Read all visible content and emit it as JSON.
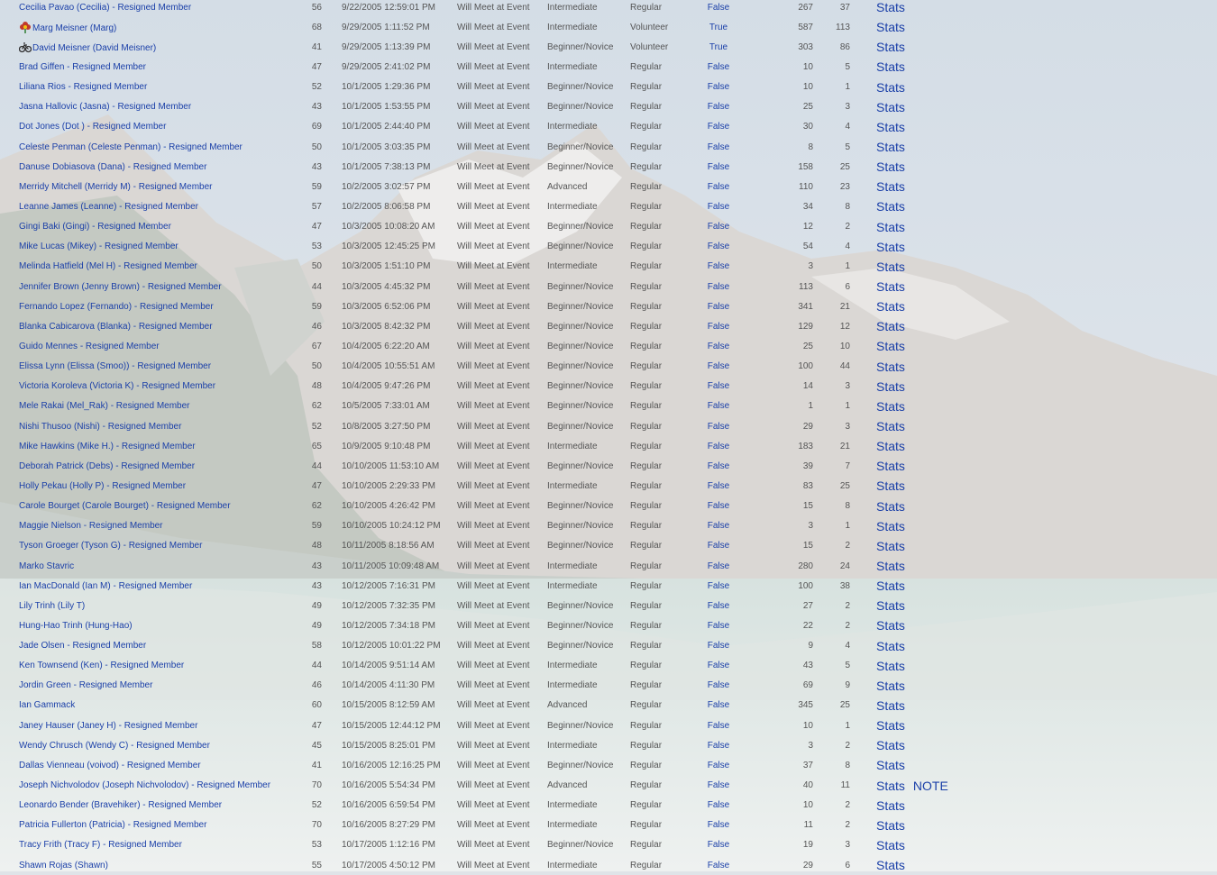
{
  "colors": {
    "link": "#1a3fa8",
    "text": "#555555"
  },
  "rows": [
    {
      "name": "Cecilia Pavao (Cecilia) - Resigned Member",
      "age": "56",
      "date": "9/22/2005 12:59:01 PM",
      "meet": "Will Meet at Event",
      "level": "Intermediate",
      "status": "Regular",
      "flag": "False",
      "n1": "267",
      "n2": "37",
      "stats": "Stats",
      "note": ""
    },
    {
      "name": "Marg Meisner (Marg)",
      "icon": "flower-icon",
      "age": "68",
      "date": "9/29/2005 1:11:52 PM",
      "meet": "Will Meet at Event",
      "level": "Intermediate",
      "status": "Volunteer",
      "flag": "True",
      "n1": "587",
      "n2": "113",
      "stats": "Stats",
      "note": ""
    },
    {
      "name": "David Meisner (David Meisner)",
      "icon": "bicycle-icon",
      "age": "41",
      "date": "9/29/2005 1:13:39 PM",
      "meet": "Will Meet at Event",
      "level": "Beginner/Novice",
      "status": "Volunteer",
      "flag": "True",
      "n1": "303",
      "n2": "86",
      "stats": "Stats",
      "note": ""
    },
    {
      "name": "Brad Giffen - Resigned Member",
      "age": "47",
      "date": "9/29/2005 2:41:02 PM",
      "meet": "Will Meet at Event",
      "level": "Intermediate",
      "status": "Regular",
      "flag": "False",
      "n1": "10",
      "n2": "5",
      "stats": "Stats",
      "note": ""
    },
    {
      "name": "Liliana Rios - Resigned Member",
      "age": "52",
      "date": "10/1/2005 1:29:36 PM",
      "meet": "Will Meet at Event",
      "level": "Beginner/Novice",
      "status": "Regular",
      "flag": "False",
      "n1": "10",
      "n2": "1",
      "stats": "Stats",
      "note": ""
    },
    {
      "name": "Jasna Hallovic (Jasna) - Resigned Member",
      "age": "43",
      "date": "10/1/2005 1:53:55 PM",
      "meet": "Will Meet at Event",
      "level": "Beginner/Novice",
      "status": "Regular",
      "flag": "False",
      "n1": "25",
      "n2": "3",
      "stats": "Stats",
      "note": ""
    },
    {
      "name": "Dot Jones (Dot ) - Resigned Member",
      "age": "69",
      "date": "10/1/2005 2:44:40 PM",
      "meet": "Will Meet at Event",
      "level": "Intermediate",
      "status": "Regular",
      "flag": "False",
      "n1": "30",
      "n2": "4",
      "stats": "Stats",
      "note": ""
    },
    {
      "name": "Celeste Penman (Celeste Penman) - Resigned Member",
      "age": "50",
      "date": "10/1/2005 3:03:35 PM",
      "meet": "Will Meet at Event",
      "level": "Beginner/Novice",
      "status": "Regular",
      "flag": "False",
      "n1": "8",
      "n2": "5",
      "stats": "Stats",
      "note": ""
    },
    {
      "name": "Danuse Dobiasova (Dana) - Resigned Member",
      "age": "43",
      "date": "10/1/2005 7:38:13 PM",
      "meet": "Will Meet at Event",
      "level": "Beginner/Novice",
      "status": "Regular",
      "flag": "False",
      "n1": "158",
      "n2": "25",
      "stats": "Stats",
      "note": ""
    },
    {
      "name": "Merridy Mitchell (Merridy M) - Resigned Member",
      "age": "59",
      "date": "10/2/2005 3:02:57 PM",
      "meet": "Will Meet at Event",
      "level": "Advanced",
      "status": "Regular",
      "flag": "False",
      "n1": "110",
      "n2": "23",
      "stats": "Stats",
      "note": ""
    },
    {
      "name": "Leanne James (Leanne) - Resigned Member",
      "age": "57",
      "date": "10/2/2005 8:06:58 PM",
      "meet": "Will Meet at Event",
      "level": "Intermediate",
      "status": "Regular",
      "flag": "False",
      "n1": "34",
      "n2": "8",
      "stats": "Stats",
      "note": ""
    },
    {
      "name": "Gingi Baki (Gingi) - Resigned Member",
      "age": "47",
      "date": "10/3/2005 10:08:20 AM",
      "meet": "Will Meet at Event",
      "level": "Beginner/Novice",
      "status": "Regular",
      "flag": "False",
      "n1": "12",
      "n2": "2",
      "stats": "Stats",
      "note": ""
    },
    {
      "name": "Mike Lucas (Mikey) - Resigned Member",
      "age": "53",
      "date": "10/3/2005 12:45:25 PM",
      "meet": "Will Meet at Event",
      "level": "Beginner/Novice",
      "status": "Regular",
      "flag": "False",
      "n1": "54",
      "n2": "4",
      "stats": "Stats",
      "note": ""
    },
    {
      "name": "Melinda Hatfield (Mel H) - Resigned Member",
      "age": "50",
      "date": "10/3/2005 1:51:10 PM",
      "meet": "Will Meet at Event",
      "level": "Intermediate",
      "status": "Regular",
      "flag": "False",
      "n1": "3",
      "n2": "1",
      "stats": "Stats",
      "note": ""
    },
    {
      "name": "Jennifer Brown (Jenny Brown) - Resigned Member",
      "age": "44",
      "date": "10/3/2005 4:45:32 PM",
      "meet": "Will Meet at Event",
      "level": "Beginner/Novice",
      "status": "Regular",
      "flag": "False",
      "n1": "113",
      "n2": "6",
      "stats": "Stats",
      "note": ""
    },
    {
      "name": "Fernando Lopez (Fernando) - Resigned Member",
      "age": "59",
      "date": "10/3/2005 6:52:06 PM",
      "meet": "Will Meet at Event",
      "level": "Beginner/Novice",
      "status": "Regular",
      "flag": "False",
      "n1": "341",
      "n2": "21",
      "stats": "Stats",
      "note": ""
    },
    {
      "name": "Blanka Cabicarova (Blanka) - Resigned Member",
      "age": "46",
      "date": "10/3/2005 8:42:32 PM",
      "meet": "Will Meet at Event",
      "level": "Beginner/Novice",
      "status": "Regular",
      "flag": "False",
      "n1": "129",
      "n2": "12",
      "stats": "Stats",
      "note": ""
    },
    {
      "name": "Guido Mennes - Resigned Member",
      "age": "67",
      "date": "10/4/2005 6:22:20 AM",
      "meet": "Will Meet at Event",
      "level": "Beginner/Novice",
      "status": "Regular",
      "flag": "False",
      "n1": "25",
      "n2": "10",
      "stats": "Stats",
      "note": ""
    },
    {
      "name": "Elissa Lynn (Elissa (Smoo)) - Resigned Member",
      "age": "50",
      "date": "10/4/2005 10:55:51 AM",
      "meet": "Will Meet at Event",
      "level": "Beginner/Novice",
      "status": "Regular",
      "flag": "False",
      "n1": "100",
      "n2": "44",
      "stats": "Stats",
      "note": ""
    },
    {
      "name": "Victoria Koroleva (Victoria K) - Resigned Member",
      "age": "48",
      "date": "10/4/2005 9:47:26 PM",
      "meet": "Will Meet at Event",
      "level": "Beginner/Novice",
      "status": "Regular",
      "flag": "False",
      "n1": "14",
      "n2": "3",
      "stats": "Stats",
      "note": ""
    },
    {
      "name": "Mele Rakai (Mel_Rak) - Resigned Member",
      "age": "62",
      "date": "10/5/2005 7:33:01 AM",
      "meet": "Will Meet at Event",
      "level": "Beginner/Novice",
      "status": "Regular",
      "flag": "False",
      "n1": "1",
      "n2": "1",
      "stats": "Stats",
      "note": ""
    },
    {
      "name": "Nishi Thusoo (Nishi) - Resigned Member",
      "age": "52",
      "date": "10/8/2005 3:27:50 PM",
      "meet": "Will Meet at Event",
      "level": "Beginner/Novice",
      "status": "Regular",
      "flag": "False",
      "n1": "29",
      "n2": "3",
      "stats": "Stats",
      "note": ""
    },
    {
      "name": "Mike Hawkins (Mike H.) - Resigned Member",
      "age": "65",
      "date": "10/9/2005 9:10:48 PM",
      "meet": "Will Meet at Event",
      "level": "Intermediate",
      "status": "Regular",
      "flag": "False",
      "n1": "183",
      "n2": "21",
      "stats": "Stats",
      "note": ""
    },
    {
      "name": "Deborah Patrick (Debs) - Resigned Member",
      "age": "44",
      "date": "10/10/2005 11:53:10 AM",
      "meet": "Will Meet at Event",
      "level": "Beginner/Novice",
      "status": "Regular",
      "flag": "False",
      "n1": "39",
      "n2": "7",
      "stats": "Stats",
      "note": ""
    },
    {
      "name": "Holly Pekau (Holly P) - Resigned Member",
      "age": "47",
      "date": "10/10/2005 2:29:33 PM",
      "meet": "Will Meet at Event",
      "level": "Intermediate",
      "status": "Regular",
      "flag": "False",
      "n1": "83",
      "n2": "25",
      "stats": "Stats",
      "note": ""
    },
    {
      "name": "Carole Bourget (Carole Bourget) - Resigned Member",
      "age": "62",
      "date": "10/10/2005 4:26:42 PM",
      "meet": "Will Meet at Event",
      "level": "Beginner/Novice",
      "status": "Regular",
      "flag": "False",
      "n1": "15",
      "n2": "8",
      "stats": "Stats",
      "note": ""
    },
    {
      "name": "Maggie Nielson - Resigned Member",
      "age": "59",
      "date": "10/10/2005 10:24:12 PM",
      "meet": "Will Meet at Event",
      "level": "Beginner/Novice",
      "status": "Regular",
      "flag": "False",
      "n1": "3",
      "n2": "1",
      "stats": "Stats",
      "note": ""
    },
    {
      "name": "Tyson Groeger (Tyson G) - Resigned Member",
      "age": "48",
      "date": "10/11/2005 8:18:56 AM",
      "meet": "Will Meet at Event",
      "level": "Beginner/Novice",
      "status": "Regular",
      "flag": "False",
      "n1": "15",
      "n2": "2",
      "stats": "Stats",
      "note": ""
    },
    {
      "name": "Marko Stavric",
      "age": "43",
      "date": "10/11/2005 10:09:48 AM",
      "meet": "Will Meet at Event",
      "level": "Intermediate",
      "status": "Regular",
      "flag": "False",
      "n1": "280",
      "n2": "24",
      "stats": "Stats",
      "note": ""
    },
    {
      "name": "Ian MacDonald (Ian M) - Resigned Member",
      "age": "43",
      "date": "10/12/2005 7:16:31 PM",
      "meet": "Will Meet at Event",
      "level": "Intermediate",
      "status": "Regular",
      "flag": "False",
      "n1": "100",
      "n2": "38",
      "stats": "Stats",
      "note": ""
    },
    {
      "name": "Lily Trinh (Lily T)",
      "age": "49",
      "date": "10/12/2005 7:32:35 PM",
      "meet": "Will Meet at Event",
      "level": "Beginner/Novice",
      "status": "Regular",
      "flag": "False",
      "n1": "27",
      "n2": "2",
      "stats": "Stats",
      "note": ""
    },
    {
      "name": "Hung-Hao Trinh (Hung-Hao)",
      "age": "49",
      "date": "10/12/2005 7:34:18 PM",
      "meet": "Will Meet at Event",
      "level": "Beginner/Novice",
      "status": "Regular",
      "flag": "False",
      "n1": "22",
      "n2": "2",
      "stats": "Stats",
      "note": ""
    },
    {
      "name": "Jade Olsen - Resigned Member",
      "age": "58",
      "date": "10/12/2005 10:01:22 PM",
      "meet": "Will Meet at Event",
      "level": "Beginner/Novice",
      "status": "Regular",
      "flag": "False",
      "n1": "9",
      "n2": "4",
      "stats": "Stats",
      "note": ""
    },
    {
      "name": "Ken Townsend (Ken) - Resigned Member",
      "age": "44",
      "date": "10/14/2005 9:51:14 AM",
      "meet": "Will Meet at Event",
      "level": "Intermediate",
      "status": "Regular",
      "flag": "False",
      "n1": "43",
      "n2": "5",
      "stats": "Stats",
      "note": ""
    },
    {
      "name": "Jordin Green - Resigned Member",
      "age": "46",
      "date": "10/14/2005 4:11:30 PM",
      "meet": "Will Meet at Event",
      "level": "Intermediate",
      "status": "Regular",
      "flag": "False",
      "n1": "69",
      "n2": "9",
      "stats": "Stats",
      "note": ""
    },
    {
      "name": "Ian Gammack",
      "age": "60",
      "date": "10/15/2005 8:12:59 AM",
      "meet": "Will Meet at Event",
      "level": "Advanced",
      "status": "Regular",
      "flag": "False",
      "n1": "345",
      "n2": "25",
      "stats": "Stats",
      "note": ""
    },
    {
      "name": "Janey Hauser (Janey H) - Resigned Member",
      "age": "47",
      "date": "10/15/2005 12:44:12 PM",
      "meet": "Will Meet at Event",
      "level": "Beginner/Novice",
      "status": "Regular",
      "flag": "False",
      "n1": "10",
      "n2": "1",
      "stats": "Stats",
      "note": ""
    },
    {
      "name": "Wendy Chrusch (Wendy C) - Resigned Member",
      "age": "45",
      "date": "10/15/2005 8:25:01 PM",
      "meet": "Will Meet at Event",
      "level": "Intermediate",
      "status": "Regular",
      "flag": "False",
      "n1": "3",
      "n2": "2",
      "stats": "Stats",
      "note": ""
    },
    {
      "name": "Dallas Vienneau (voivod) - Resigned Member",
      "age": "41",
      "date": "10/16/2005 12:16:25 PM",
      "meet": "Will Meet at Event",
      "level": "Beginner/Novice",
      "status": "Regular",
      "flag": "False",
      "n1": "37",
      "n2": "8",
      "stats": "Stats",
      "note": ""
    },
    {
      "name": "Joseph Nichvolodov (Joseph Nichvolodov) - Resigned Member",
      "age": "70",
      "date": "10/16/2005 5:54:34 PM",
      "meet": "Will Meet at Event",
      "level": "Advanced",
      "status": "Regular",
      "flag": "False",
      "n1": "40",
      "n2": "11",
      "stats": "Stats",
      "note": "NOTE"
    },
    {
      "name": "Leonardo Bender (Bravehiker) - Resigned Member",
      "age": "52",
      "date": "10/16/2005 6:59:54 PM",
      "meet": "Will Meet at Event",
      "level": "Intermediate",
      "status": "Regular",
      "flag": "False",
      "n1": "10",
      "n2": "2",
      "stats": "Stats",
      "note": ""
    },
    {
      "name": "Patricia Fullerton (Patricia) - Resigned Member",
      "age": "70",
      "date": "10/16/2005 8:27:29 PM",
      "meet": "Will Meet at Event",
      "level": "Intermediate",
      "status": "Regular",
      "flag": "False",
      "n1": "11",
      "n2": "2",
      "stats": "Stats",
      "note": ""
    },
    {
      "name": "Tracy Frith (Tracy F) - Resigned Member",
      "age": "53",
      "date": "10/17/2005 1:12:16 PM",
      "meet": "Will Meet at Event",
      "level": "Beginner/Novice",
      "status": "Regular",
      "flag": "False",
      "n1": "19",
      "n2": "3",
      "stats": "Stats",
      "note": ""
    },
    {
      "name": "Shawn Rojas (Shawn)",
      "age": "55",
      "date": "10/17/2005 4:50:12 PM",
      "meet": "Will Meet at Event",
      "level": "Intermediate",
      "status": "Regular",
      "flag": "False",
      "n1": "29",
      "n2": "6",
      "stats": "Stats",
      "note": ""
    }
  ]
}
